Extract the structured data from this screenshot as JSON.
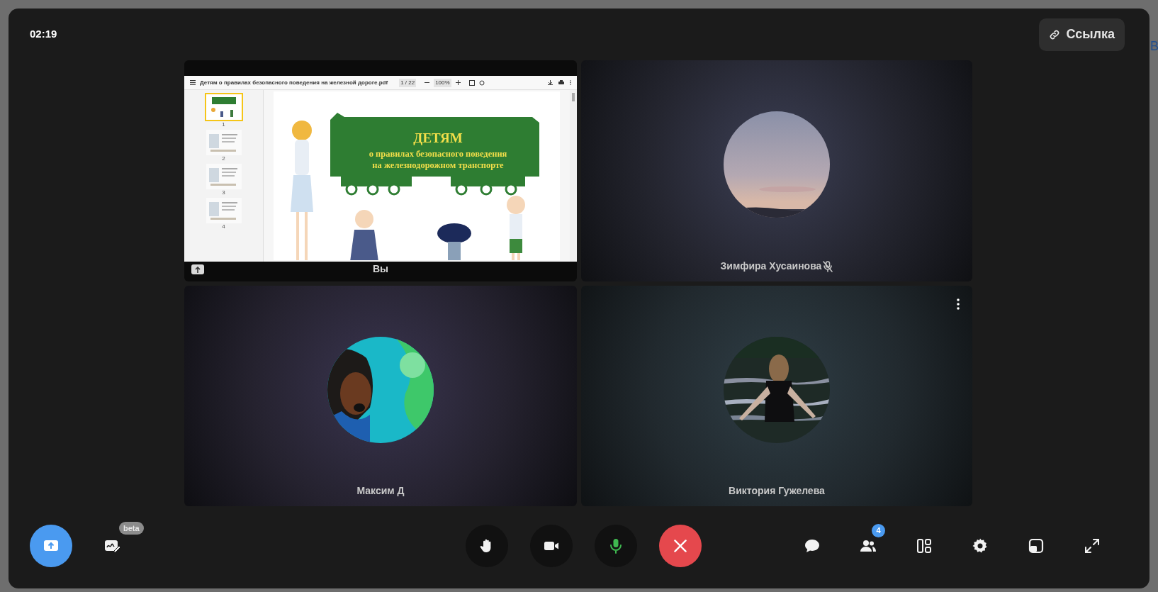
{
  "background": {
    "right_letter": "В"
  },
  "call": {
    "timer": "02:19",
    "link_button": "Ссылка"
  },
  "shared_screen": {
    "owner": "Вы",
    "file_name": "Детям о правилах безопасного поведения на железной дороге.pdf",
    "page": "1 / 22",
    "zoom": "100%",
    "thumbnails": [
      {
        "label": "1",
        "selected": true
      },
      {
        "label": "2",
        "selected": false
      },
      {
        "label": "3",
        "selected": false
      },
      {
        "label": "4",
        "selected": false
      }
    ],
    "slide": {
      "heading": "ДЕТЯМ",
      "line_1": "о правилах безопасного поведения",
      "line_2": "на железнодорожном транспорте"
    }
  },
  "participants": [
    {
      "name": "Зимфира Хусаинова",
      "muted": true,
      "menu": false
    },
    {
      "name": "Максим Д",
      "muted": false,
      "menu": false
    },
    {
      "name": "Виктория Гужелева",
      "muted": false,
      "menu": true
    }
  ],
  "toolbar": {
    "left": [
      {
        "kind": "share",
        "active": true
      },
      {
        "kind": "board",
        "badge": "beta"
      }
    ],
    "center": [
      {
        "kind": "hand"
      },
      {
        "kind": "camera"
      },
      {
        "kind": "mic",
        "on": true
      },
      {
        "kind": "hangup"
      }
    ],
    "right": [
      {
        "kind": "chat"
      },
      {
        "kind": "people",
        "badge": "4"
      },
      {
        "kind": "layout"
      },
      {
        "kind": "settings"
      },
      {
        "kind": "pip"
      },
      {
        "kind": "fullscreen"
      }
    ]
  }
}
